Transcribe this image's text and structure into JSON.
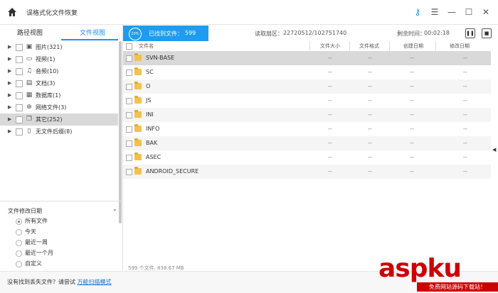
{
  "app": {
    "title": "误格式化文件恢复"
  },
  "tabs": {
    "path_view": "路径视图",
    "file_view": "文件视图"
  },
  "tree": [
    {
      "label": "图片(321)",
      "icon": "image-icon"
    },
    {
      "label": "视频(1)",
      "icon": "video-icon"
    },
    {
      "label": "音频(10)",
      "icon": "audio-icon"
    },
    {
      "label": "文档(3)",
      "icon": "document-icon"
    },
    {
      "label": "数据库(1)",
      "icon": "database-icon"
    },
    {
      "label": "网络文件(3)",
      "icon": "globe-icon"
    },
    {
      "label": "其它(252)",
      "icon": "other-files-icon",
      "selected": true
    },
    {
      "label": "无文件后缀(8)",
      "icon": "file-icon"
    }
  ],
  "filter": {
    "title": "文件修改日期",
    "options": [
      "所有文件",
      "今天",
      "最近一周",
      "最近一个月",
      "自定义"
    ],
    "selected": "所有文件"
  },
  "status": {
    "percent": "23%",
    "found_label": "已找到文件：",
    "found_count": "599",
    "sector_label": "读取扇区：",
    "sector_value": "22720512/102751740",
    "remaining_label": "剩余时间：",
    "remaining_value": "00:02:18"
  },
  "table": {
    "headers": [
      "文件名",
      "文件大小",
      "文件格式",
      "创建日期",
      "修改日期"
    ],
    "rows": [
      {
        "name": "SVN-BASE",
        "size": "--",
        "format": "--",
        "created": "--",
        "modified": "--"
      },
      {
        "name": "SC",
        "size": "--",
        "format": "--",
        "created": "--",
        "modified": "--"
      },
      {
        "name": "O",
        "size": "--",
        "format": "--",
        "created": "--",
        "modified": "--"
      },
      {
        "name": "JS",
        "size": "--",
        "format": "--",
        "created": "--",
        "modified": "--"
      },
      {
        "name": "INI",
        "size": "--",
        "format": "--",
        "created": "--",
        "modified": "--"
      },
      {
        "name": "INFO",
        "size": "--",
        "format": "--",
        "created": "--",
        "modified": "--"
      },
      {
        "name": "BAK",
        "size": "--",
        "format": "--",
        "created": "--",
        "modified": "--"
      },
      {
        "name": "ASEC",
        "size": "--",
        "format": "--",
        "created": "--",
        "modified": "--"
      },
      {
        "name": "ANDROID_SECURE",
        "size": "--",
        "format": "--",
        "created": "--",
        "modified": "--"
      }
    ],
    "footer": "599 个文件, 838.67 MB"
  },
  "bottom": {
    "prompt": "没有找到丢失文件？请尝试 ",
    "link": "万能扫描模式"
  },
  "watermark": {
    "main": "aspku",
    "sub": "免费网站源码下载站！"
  },
  "colors": {
    "accent": "#1e9df0",
    "link": "#1e6fd8",
    "selected_row": "#d9d9d9",
    "folder": "#f2c14e"
  }
}
